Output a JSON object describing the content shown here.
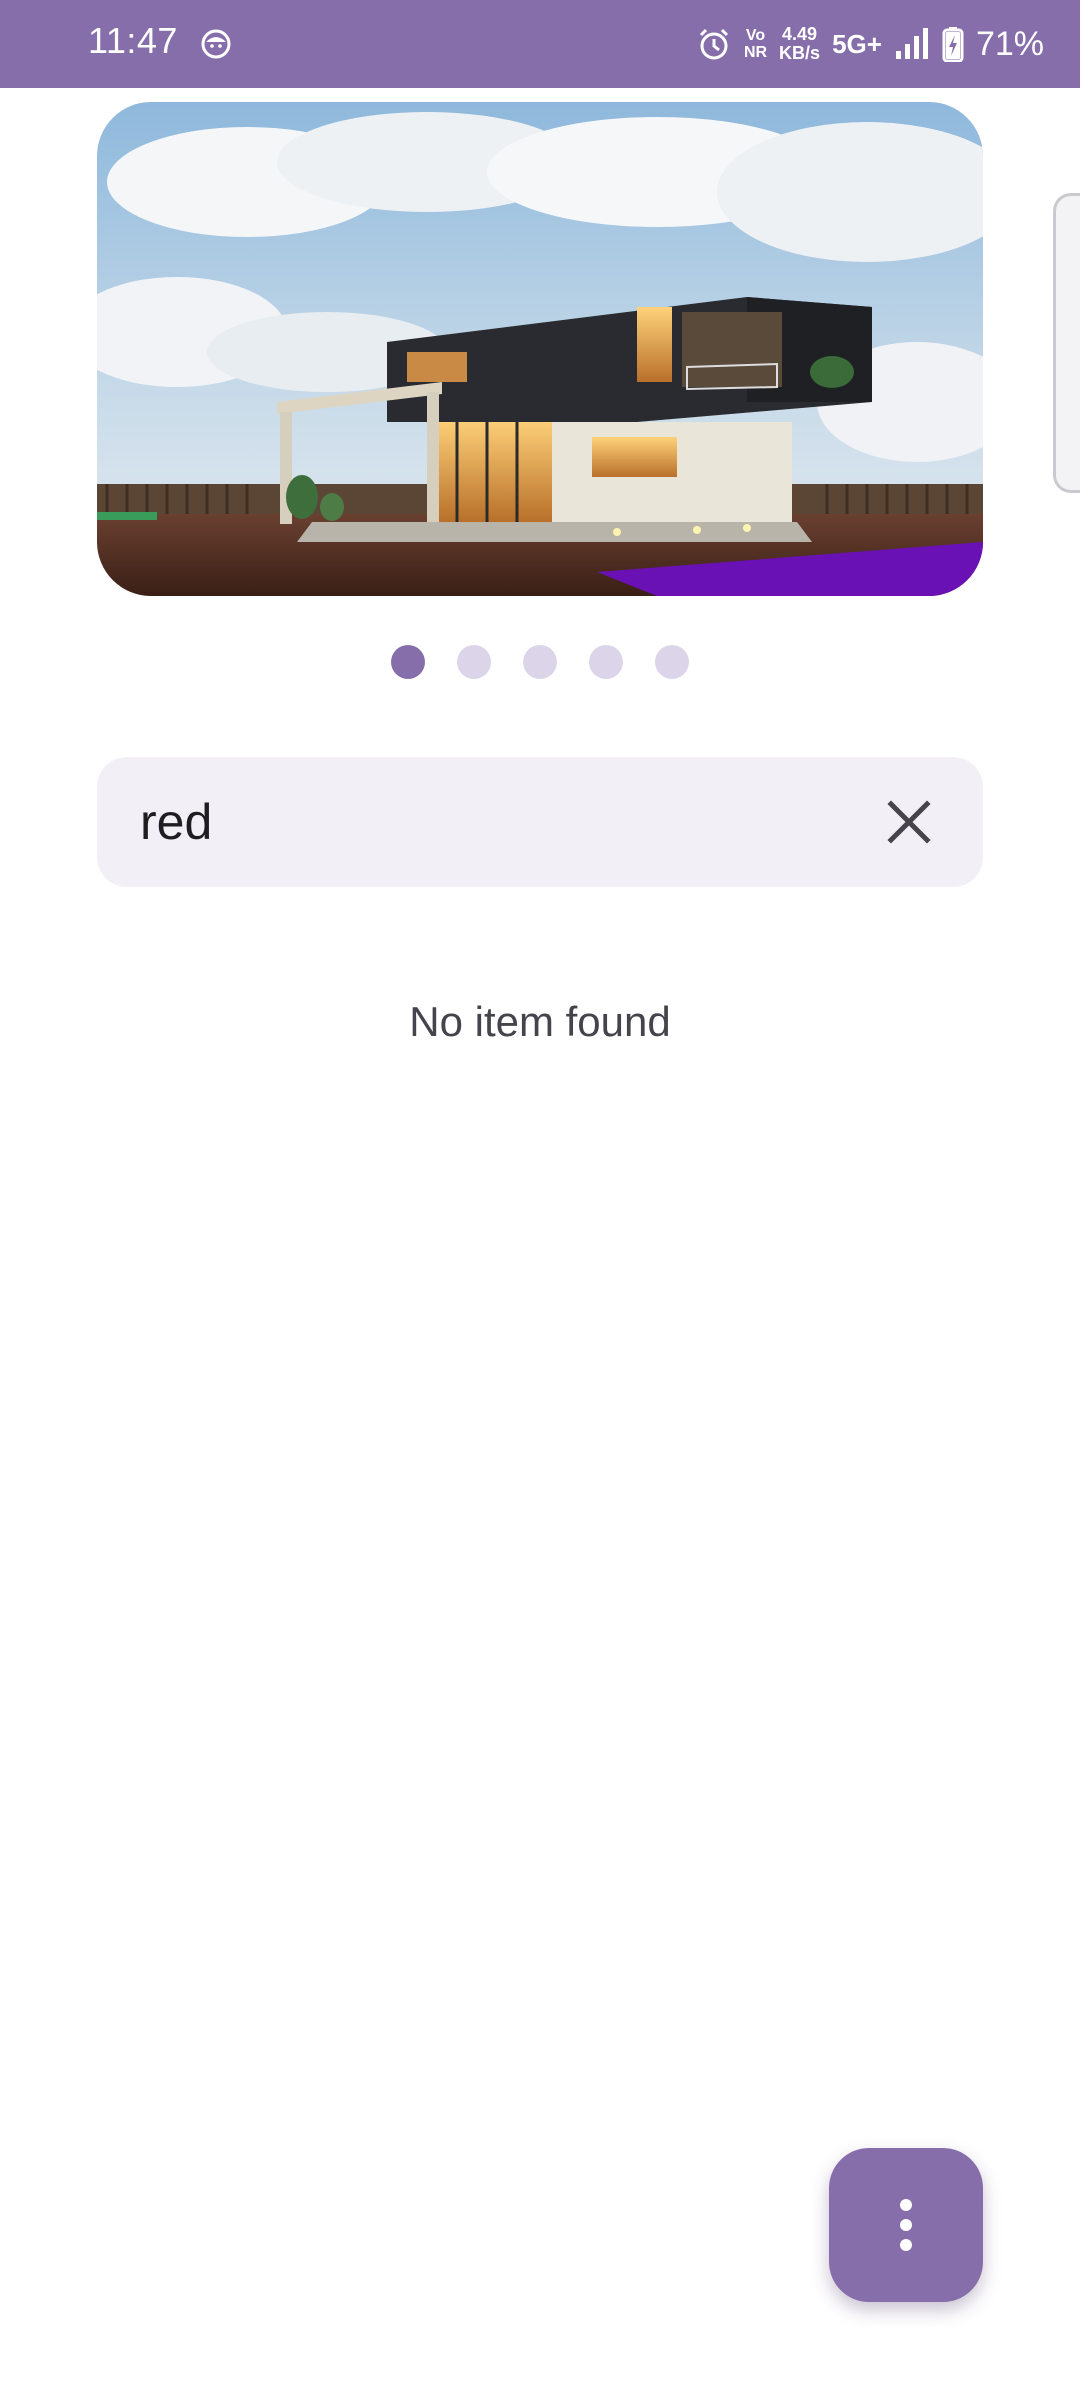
{
  "status_bar": {
    "time": "11:47",
    "network_speed_value": "4.49",
    "network_speed_unit": "KB/s",
    "vonr_top": "Vo",
    "vonr_bottom": "NR",
    "network_type": "5G+",
    "battery_percent": "71%",
    "icons": [
      "face-icon",
      "alarm-icon",
      "vonr-icon",
      "signal-icon",
      "battery-charging-icon"
    ]
  },
  "carousel": {
    "image_icon": "modern-house-image",
    "page_count": 5,
    "active_index": 0
  },
  "search": {
    "value": "red",
    "placeholder": "",
    "clear_icon": "close-icon"
  },
  "results": {
    "empty_message": "No item found"
  },
  "fab": {
    "icon": "more-vertical-icon"
  },
  "colors": {
    "primary": "#866eab",
    "dot_inactive": "#dcd4e9",
    "search_bg": "#f2eff6"
  }
}
